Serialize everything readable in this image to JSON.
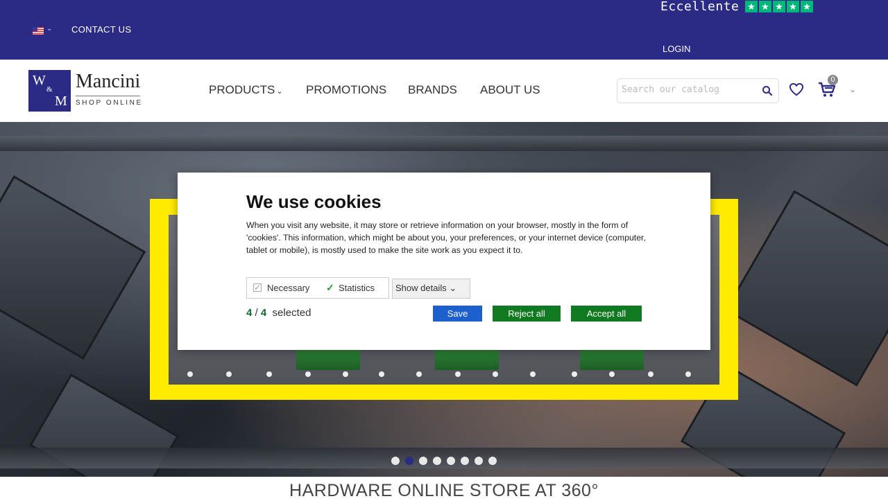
{
  "topbar": {
    "contact": "CONTACT US",
    "trust_label": "Eccellente",
    "stars": [
      "★",
      "★",
      "★",
      "★",
      "★"
    ],
    "login": "LOGIN"
  },
  "header": {
    "logo": {
      "w": "W",
      "amp": "&",
      "m": "M",
      "name": "Mancini",
      "sub": "SHOP ONLINE"
    },
    "nav": [
      {
        "label": "PRODUCTS",
        "dropdown": true
      },
      {
        "label": "PROMOTIONS"
      },
      {
        "label": "BRANDS"
      },
      {
        "label": "ABOUT US"
      }
    ],
    "search_placeholder": "Search our catalog",
    "cart_count": "0"
  },
  "hero": {
    "slides": 8,
    "active_slide": 2
  },
  "tagline": "HARDWARE ONLINE STORE AT 360°",
  "cookie": {
    "title": "We use cookies",
    "text": "When you visit any website, it may store or retrieve information on your browser, mostly in the form of 'cookies'. This information, which might be about you, your preferences, or your internet device (computer, tablet or mobile), is mostly used to make the site work as you expect it to.",
    "necessary": "Necessary",
    "statistics": "Statistics",
    "show_details": "Show details",
    "selected_count": "4",
    "selected_total": "4",
    "selected_label": "selected",
    "save": "Save",
    "reject": "Reject all",
    "accept": "Accept all"
  },
  "colors": {
    "brand": "#2b2a86",
    "trustpilot": "#00b67a",
    "accept": "#0f7a1f",
    "save": "#1d5fcc",
    "frame": "#ffeb00"
  }
}
